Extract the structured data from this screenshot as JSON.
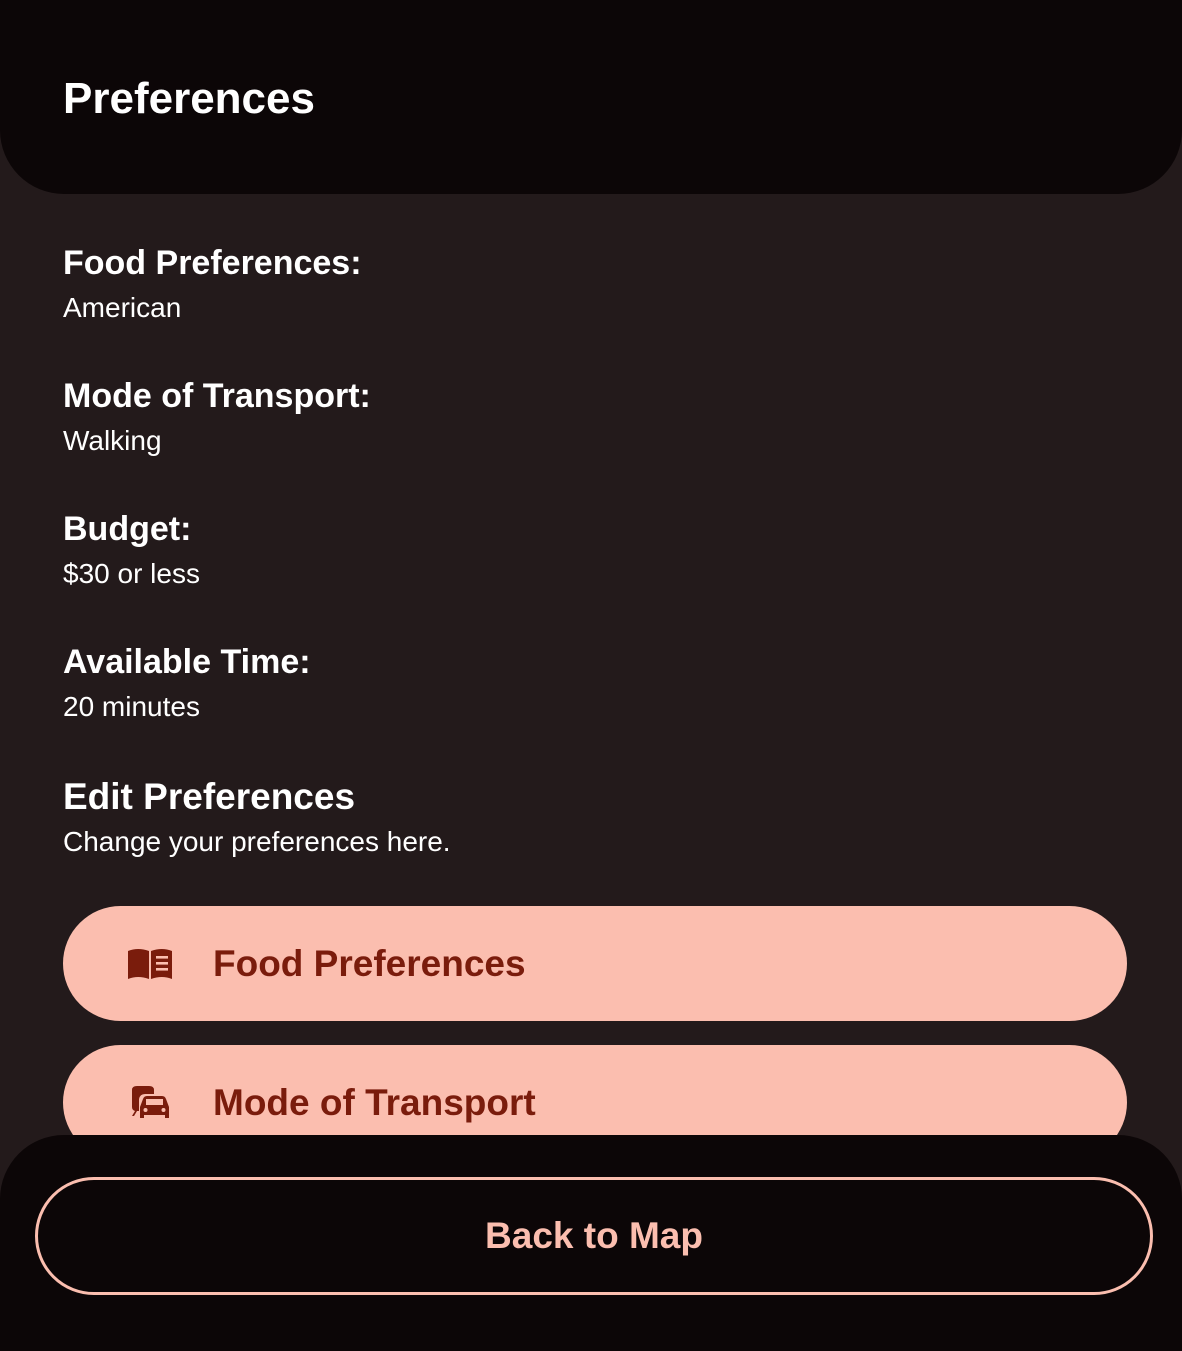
{
  "header": {
    "title": "Preferences"
  },
  "preferences": [
    {
      "label": "Food Preferences:",
      "value": "American"
    },
    {
      "label": "Mode of Transport:",
      "value": "Walking"
    },
    {
      "label": "Budget:",
      "value": "$30 or less"
    },
    {
      "label": "Available Time:",
      "value": "20 minutes"
    }
  ],
  "edit": {
    "title": "Edit Preferences",
    "subtitle": "Change your preferences here."
  },
  "buttons": [
    {
      "label": "Food Preferences",
      "icon": "menu-book-icon"
    },
    {
      "label": "Mode of Transport",
      "icon": "commute-icon"
    }
  ],
  "footer": {
    "back_label": "Back to Map"
  },
  "colors": {
    "background": "#231a1b",
    "header_background": "#0c0607",
    "accent": "#fbbeaf",
    "accent_text": "#7a1c0c",
    "text": "#ffffff"
  }
}
